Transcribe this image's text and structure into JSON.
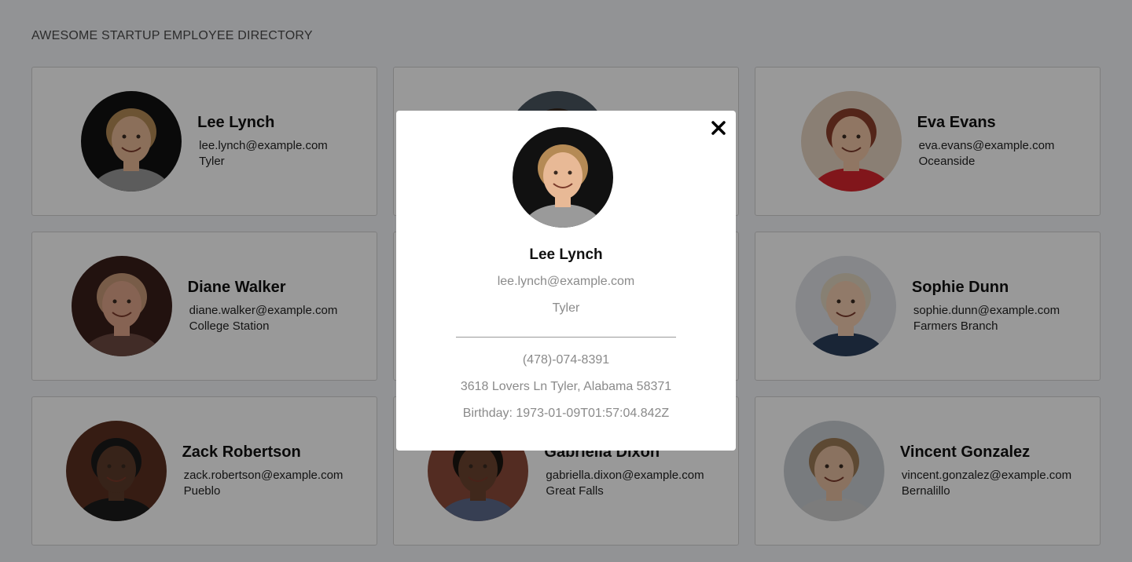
{
  "header": {
    "title": "AWESOME STARTUP EMPLOYEE DIRECTORY"
  },
  "employees": [
    {
      "name": "Lee Lynch",
      "email": "lee.lynch@example.com",
      "city": "Tyler",
      "bg": "#111111",
      "skin": "#e8b996",
      "hair": "#b58a55",
      "shirt": "#9a9a9a"
    },
    {
      "name": "",
      "email": "",
      "city": "",
      "bg": "#4a5560",
      "skin": "#d9a582",
      "hair": "#3a2c22",
      "shirt": "#4d4d4d"
    },
    {
      "name": "Eva Evans",
      "email": "eva.evans@example.com",
      "city": "Oceanside",
      "bg": "#e6d4c2",
      "skin": "#f0c5a5",
      "hair": "#8a3e2a",
      "shirt": "#d8262d"
    },
    {
      "name": "Diane Walker",
      "email": "diane.walker@example.com",
      "city": "College Station",
      "bg": "#3a1e1a",
      "skin": "#e0a58a",
      "hair": "#c99a78",
      "shirt": "#6d4a42"
    },
    {
      "name": "",
      "email": "",
      "city": "",
      "bg": "#9aa3ac",
      "skin": "#e0b497",
      "hair": "#5a3f2e",
      "shirt": "#7a7a7a"
    },
    {
      "name": "Sophie Dunn",
      "email": "sophie.dunn@example.com",
      "city": "Farmers Branch",
      "bg": "#dfe2e6",
      "skin": "#f2cbb0",
      "hair": "#e1d6c0",
      "shirt": "#2b3e5a"
    },
    {
      "name": "Zack Robertson",
      "email": "zack.robertson@example.com",
      "city": "Pueblo",
      "bg": "#5a2f20",
      "skin": "#5c3b2a",
      "hair": "#1a1a1a",
      "shirt": "#1c1c1c"
    },
    {
      "name": "Gabriella Dixon",
      "email": "gabriella.dixon@example.com",
      "city": "Great Falls",
      "bg": "#8a4a3a",
      "skin": "#6b4330",
      "hair": "#1a1410",
      "shirt": "#5c6a8a"
    },
    {
      "name": "Vincent Gonzalez",
      "email": "vincent.gonzalez@example.com",
      "city": "Bernalillo",
      "bg": "#c9cdd2",
      "skin": "#e6bfa0",
      "hair": "#9c7a55",
      "shirt": "#cfcfcf"
    }
  ],
  "modal": {
    "name": "Lee Lynch",
    "email": "lee.lynch@example.com",
    "city": "Tyler",
    "phone": "(478)-074-8391",
    "address": "3618 Lovers Ln Tyler, Alabama 58371",
    "birthday": "Birthday: 1973-01-09T01:57:04.842Z"
  },
  "icons": {
    "close": "close-icon"
  }
}
